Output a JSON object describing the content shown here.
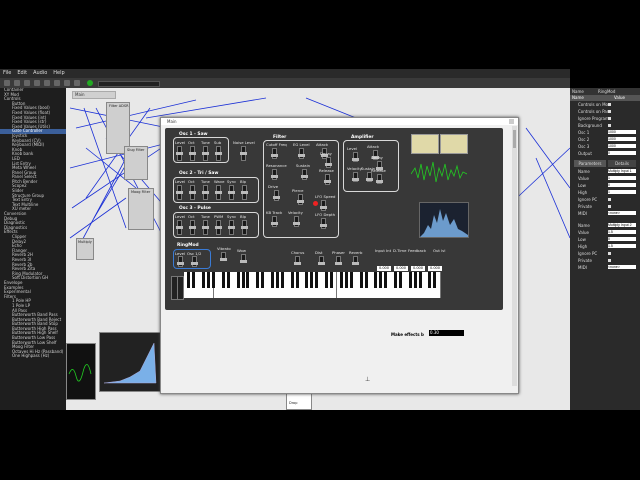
{
  "menu": [
    "File",
    "Edit",
    "Audio",
    "Help"
  ],
  "tree": {
    "items": [
      "Container",
      "XY Mod",
      "Controls",
      "Button",
      "Fixed Values (bool)",
      "Fixed Values (float)",
      "Fixed Values (int)",
      "Fixed Values (str)",
      "Fixed Values (Utils)",
      "Gate Controller",
      "Joystick",
      "Keyboard (CV)",
      "Keyboard (MIDI)",
      "Knob",
      "Knob bank",
      "LED",
      "List Entry",
      "Meta Wheel",
      "Panel Group",
      "Panel Select",
      "Pitch Bender",
      "Scope2",
      "Slider",
      "Structure Group",
      "Text Entry",
      "Text Multiline",
      "XU meter",
      "Conversion",
      "Debug",
      "Diagnostic",
      "Diagnostics",
      "Effects",
      "Clipper",
      "Delay2",
      "Echo",
      "Flanger",
      "Reverb 2H",
      "Reverb 3I",
      "Reverb 2b",
      "Reverb Zita",
      "Ring Modulator",
      "Soft Distortion GH",
      "Envelope",
      "Examples",
      "Experimental",
      "Filters",
      "1 Pole HP",
      "1 Pole LP",
      "All Pass",
      "Butterworth Band Pass",
      "Butterworth Band Reject",
      "Butterworth Band Stop",
      "Butterworth High Pass",
      "Butterworth High Shelf",
      "Butterworth Low Pass",
      "Butterworth Low Shelf",
      "Moog Filter",
      "Octaves Hi Hz (Passband)",
      "One Highpass (Hz)"
    ],
    "selected_index": 9
  },
  "canvas": {
    "tab_title": "Main",
    "nodes": [
      "Filter ADSR",
      "Slug Filter",
      "Moog Filter",
      "Multiply",
      "Drop"
    ]
  },
  "plugin": {
    "title": "Main",
    "osc1": {
      "title": "Osc 1 - Saw",
      "labels": [
        "Level",
        "Oct",
        "Tune",
        "Sub"
      ]
    },
    "noise": {
      "label": "Noise Level"
    },
    "osc2": {
      "title": "Osc 2 - Tri / Saw",
      "labels": [
        "Level",
        "Oct",
        "Tune",
        "Wave",
        "Sync",
        "Blp"
      ]
    },
    "osc3": {
      "title": "Osc 3 - Pulse",
      "labels": [
        "Level",
        "Oct",
        "Tune",
        "PWM",
        "Sync",
        "Blp"
      ]
    },
    "filter": {
      "title": "Filter",
      "labels": [
        "Cutoff Freq",
        "EG Level",
        "Attack",
        "Decay",
        "Sustain",
        "Release",
        "Resonance",
        "Drive",
        "Pierce",
        "LFO Speed",
        "LFO Depth",
        "KB Track",
        "Velocity"
      ]
    },
    "amp": {
      "title": "Amplifier",
      "labels": [
        "Level",
        "Attack",
        "Decay",
        "Sustain",
        "Release",
        "Velocity"
      ]
    },
    "ringmod": {
      "title": "RingMod",
      "labels": [
        "Level",
        "Osc 1/2"
      ]
    },
    "misc": [
      "Vibrato",
      "Wow",
      "Chorus",
      "Dist",
      "Phaser",
      "Reverb",
      "Input Int",
      "D.Time",
      "Feedback",
      "Out lvl"
    ],
    "fx_values": [
      "0.000",
      "0.000",
      "0.000",
      "0.000"
    ],
    "bypass_label": "Make effects b",
    "bypass_value": "0.30"
  },
  "right_panel": {
    "top_header": [
      "Name",
      "RingMod"
    ],
    "col_headers": [
      "Name",
      "Value"
    ],
    "rows1": [
      {
        "label": "Controls on Mo",
        "type": "check"
      },
      {
        "label": "Controls on Par",
        "type": "check"
      },
      {
        "label": "Ignore Program",
        "type": "check"
      },
      {
        "label": "Background",
        "type": "check"
      },
      {
        "label": "Osc 1",
        "value": "1000"
      },
      {
        "label": "Osc 2",
        "value": "1000"
      },
      {
        "label": "Osc 3",
        "value": "1000"
      },
      {
        "label": "Output",
        "value": "0"
      }
    ],
    "tabs": [
      "Parameters",
      "Details"
    ],
    "rows2": [
      {
        "label": "Name",
        "value": "Multiply Input 1"
      },
      {
        "label": "Value",
        "value": "1"
      },
      {
        "label": "Low",
        "value": "0"
      },
      {
        "label": "High",
        "value": "1"
      },
      {
        "label": "Ignore PC",
        "type": "check"
      },
      {
        "label": "Private",
        "type": "check"
      },
      {
        "label": "MIDI",
        "value": "<none>"
      }
    ],
    "rows3": [
      {
        "label": "Name",
        "value": "Multiply Input 2"
      },
      {
        "label": "Value",
        "value": "1.5"
      },
      {
        "label": "Low",
        "value": "0"
      },
      {
        "label": "High",
        "value": "1.5"
      },
      {
        "label": "Ignore PC",
        "type": "check"
      },
      {
        "label": "Private",
        "type": "check"
      },
      {
        "label": "MIDI",
        "value": "<none>"
      }
    ]
  },
  "colors": {
    "wire": "#1a2fd6",
    "panel": "#383838",
    "waveform": "#22cc22",
    "spectrum": "#7ab0e8"
  }
}
